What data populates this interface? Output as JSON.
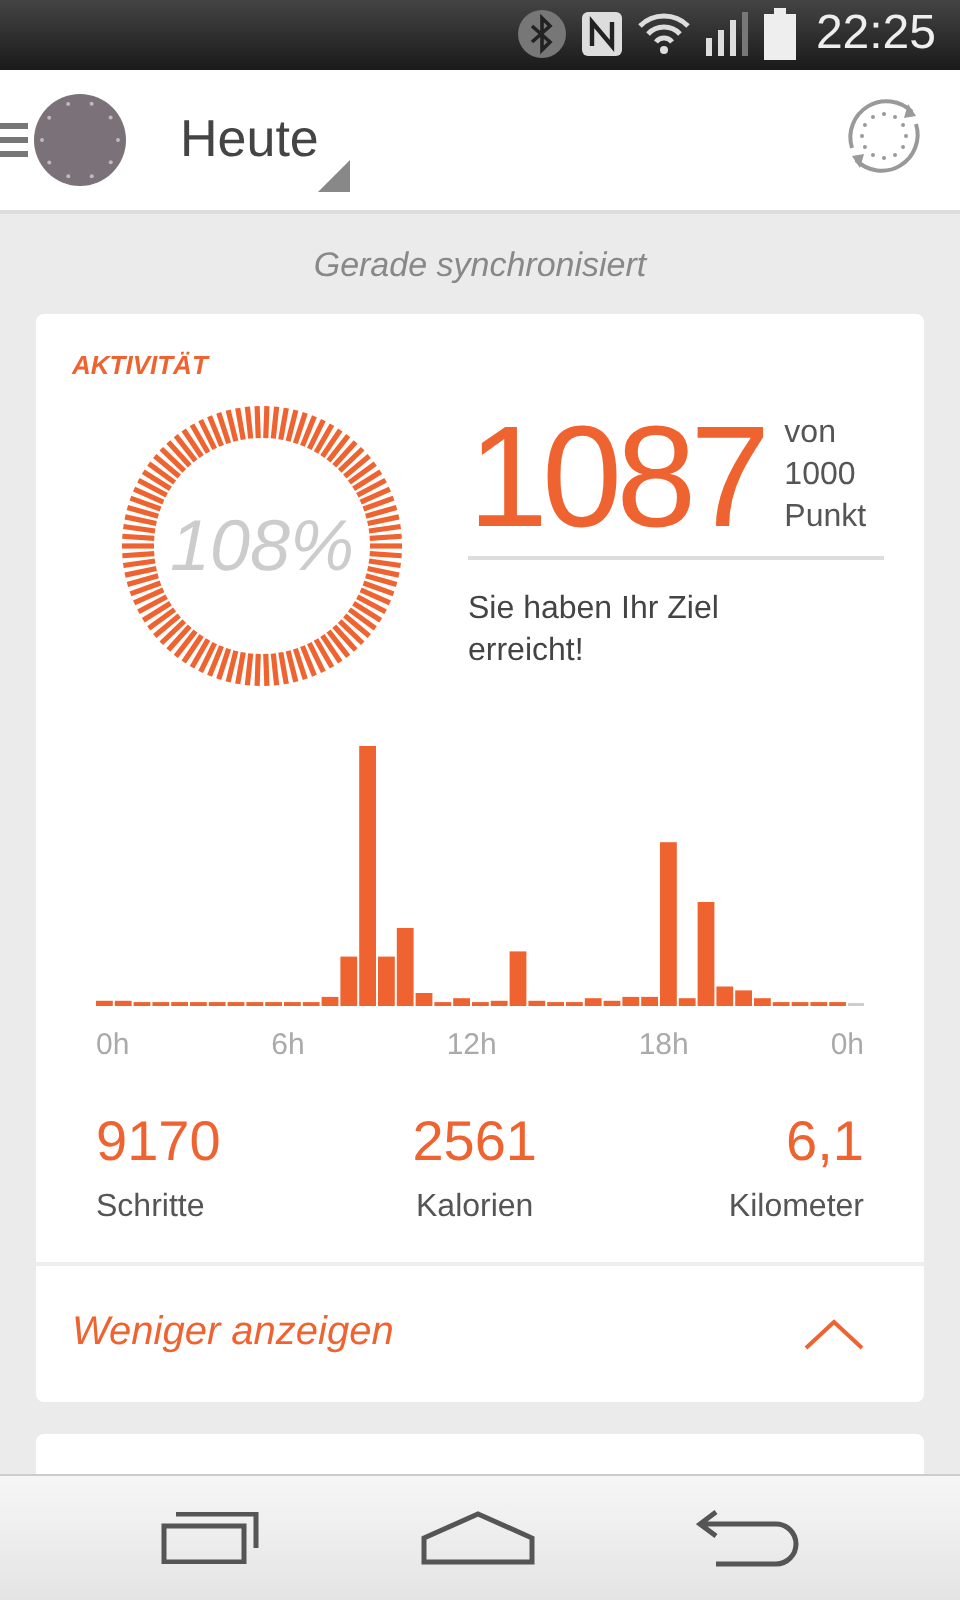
{
  "status_bar": {
    "time": "22:25"
  },
  "header": {
    "title": "Heute"
  },
  "sync_status": "Gerade synchronisiert",
  "activity_card": {
    "heading": "AKTIVITÄT",
    "ring_text": "108%",
    "points": "1087",
    "points_suffix": "von 1000 Punkt",
    "message": "Sie haben Ihr Ziel erreicht!",
    "chart_labels": [
      "0h",
      "6h",
      "12h",
      "18h",
      "0h"
    ],
    "stats": [
      {
        "value": "9170",
        "label": "Schritte"
      },
      {
        "value": "2561",
        "label": "Kalorien"
      },
      {
        "value": "6,1",
        "label": "Kilometer"
      }
    ],
    "toggle": {
      "label": "Weniger anzeigen",
      "expanded": true
    }
  }
}
